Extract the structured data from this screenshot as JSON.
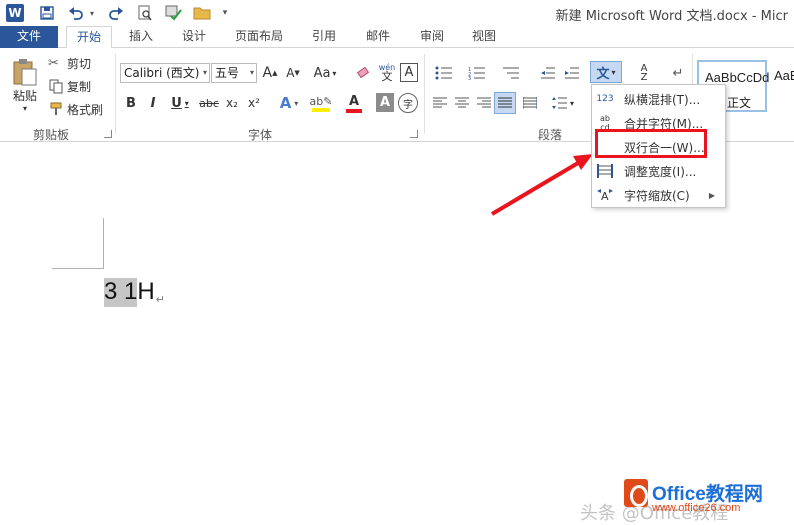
{
  "window": {
    "title": "新建 Microsoft Word 文档.docx - Micr",
    "quick_access": [
      "word-logo-icon",
      "save-icon",
      "undo-icon",
      "redo-icon",
      "print-preview-icon",
      "spellcheck-icon",
      "open-folder-icon",
      "customize-icon"
    ]
  },
  "tabs": [
    "文件",
    "开始",
    "插入",
    "设计",
    "页面布局",
    "引用",
    "邮件",
    "审阅",
    "视图"
  ],
  "active_tab": "开始",
  "clipboard": {
    "paste": "粘贴",
    "cut": "剪切",
    "copy": "复制",
    "format_painter": "格式刷",
    "group": "剪贴板"
  },
  "font": {
    "name": "Calibri (西文)",
    "size": "五号",
    "group": "字体",
    "bold": "B",
    "italic": "I",
    "underline": "U",
    "strike": "abc",
    "subscript": "x₂",
    "superscript": "x²",
    "change_case": "Aa",
    "phonetic": "wén",
    "border_char": "A",
    "enclose": "字"
  },
  "paragraph": {
    "group": "段落"
  },
  "styles": {
    "sample": "AaBbCcDd",
    "sample2": "AaB",
    "normal": "正文"
  },
  "document": {
    "selected_text": "3 1",
    "text_after": "H",
    "para_mark": "↵"
  },
  "menu": {
    "items": [
      {
        "icon_text": "123",
        "label": "纵横混排(T)..."
      },
      {
        "icon_text": "ab\ncd",
        "label": "合并字符(M)..."
      },
      {
        "icon_text": "",
        "label": "双行合一(W)..."
      },
      {
        "icon_text": "",
        "label": "调整宽度(I)..."
      },
      {
        "icon_text": "",
        "label": "字符缩放(C)"
      }
    ]
  },
  "watermark": {
    "title": "Office教程网",
    "url": "www.office26.com",
    "faint": "头条 @Office教程"
  },
  "colors": {
    "accent": "#2b579a",
    "highlight_border": "#e8141e",
    "selection_gray": "#c6c6c6",
    "font_color_bar": "#e8141e",
    "highlighter_bar": "#ffee00"
  }
}
